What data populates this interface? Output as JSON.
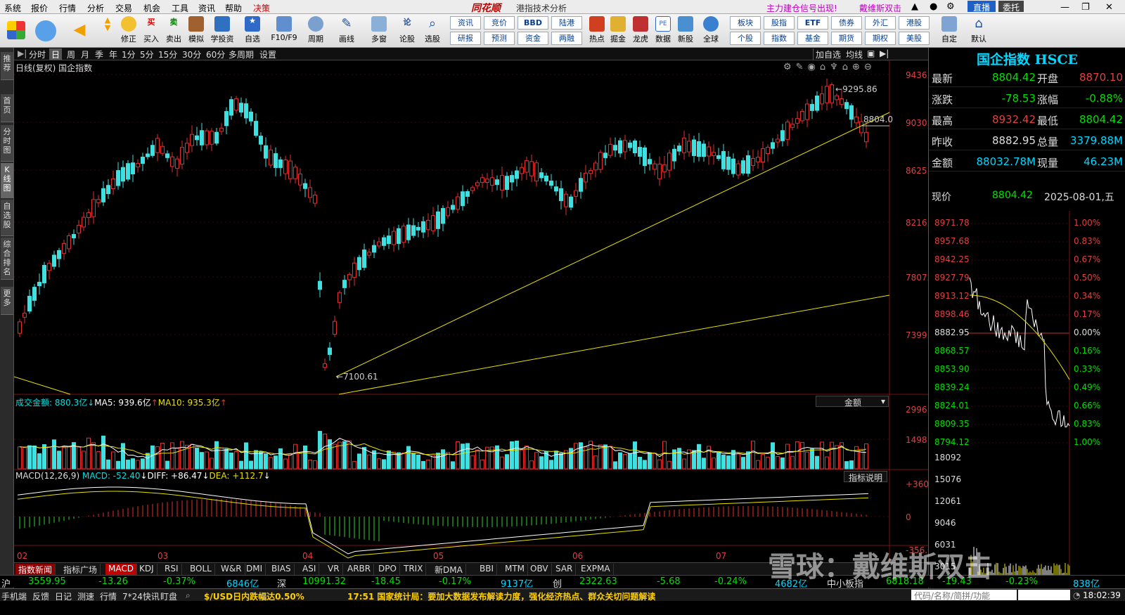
{
  "menu": {
    "items": [
      "系统",
      "报价",
      "行情",
      "分析",
      "交易",
      "机会",
      "工具",
      "资讯",
      "帮助",
      "决策"
    ],
    "brand": "同花顺",
    "title": "港指技术分析",
    "promo1": "主力建仓信号出现!",
    "promo2": "戴维斯双击",
    "live_btn": "直播",
    "delegate_btn": "委托"
  },
  "toolbar": {
    "big": [
      "修正",
      "买入",
      "卖出",
      "模拟",
      "学投资",
      "自选",
      "F10/F9",
      "周期",
      "画线",
      "多窗",
      "论股",
      "选股",
      "热点",
      "掘金",
      "龙虎",
      "数据",
      "新股",
      "全球",
      "自定",
      "默认"
    ],
    "grid_top": [
      "资讯",
      "竞价",
      "BBD",
      "陆港",
      "板块",
      "股指",
      "ETF",
      "债券",
      "外汇",
      "港股"
    ],
    "grid_bottom": [
      "研报",
      "预测",
      "资金",
      "两融",
      "个股",
      "指数",
      "基金",
      "期货",
      "期权",
      "美股"
    ]
  },
  "leftbar": [
    "推荐",
    "首页",
    "分时图",
    "K线图",
    "自选股",
    "综合排名",
    "更多"
  ],
  "periods": [
    "分时",
    "日",
    "周",
    "月",
    "季",
    "年",
    "1分",
    "5分",
    "15分",
    "30分",
    "60分",
    "多周期",
    "设置"
  ],
  "period_right": [
    "加自选",
    "均线"
  ],
  "chart": {
    "header": "日线(复权)  国企指数",
    "high_label": "9295.86",
    "low_label": "7100.61",
    "last_label": "8804.0",
    "yaxis": [
      "9436.03",
      "9030.20",
      "8625.08",
      "8216.86",
      "7807.75",
      "7399.84"
    ],
    "months": [
      "02",
      "03",
      "04",
      "05",
      "06",
      "07"
    ]
  },
  "volume": {
    "label": "成交金额: 880.3亿",
    "ma5": "MA5: 939.6亿",
    "ma10": "MA10: 935.3亿",
    "select": "金额",
    "yaxis": [
      "2996",
      "1498"
    ]
  },
  "macd": {
    "label": "MACD(12,26,9)",
    "macd": "MACD: -52.40",
    "diff": "DIFF: +86.47",
    "dea": "DEA: +112.7",
    "explain": "指标说明",
    "yaxis": [
      "+360.8",
      "0",
      "-356.0"
    ]
  },
  "tabs": [
    "指数新闻",
    "指标广场",
    "MACD",
    "KDJ",
    "RSI",
    "BOLL",
    "W&R",
    "DMI",
    "BIAS",
    "ASI",
    "VR",
    "ARBR",
    "DPO",
    "TRIX",
    "新DMA",
    "BBI",
    "MTM",
    "OBV",
    "SAR",
    "EXPMA"
  ],
  "quote": {
    "title": "国企指数 HSCE",
    "rows": [
      [
        "最新",
        "8804.42",
        "开盘",
        "8870.10"
      ],
      [
        "涨跌",
        "-78.53",
        "涨幅",
        "-0.88%"
      ],
      [
        "最高",
        "8932.42",
        "最低",
        "8804.42"
      ],
      [
        "昨收",
        "8882.95",
        "总量",
        "3379.88M"
      ],
      [
        "金额",
        "88032.78M",
        "现量",
        "46.23M"
      ]
    ],
    "now_label": "现价",
    "now_val": "8804.42",
    "date": "2025-08-01,五",
    "prices": [
      "8971.78",
      "8957.68",
      "8942.25",
      "8927.79",
      "8913.12",
      "8898.46",
      "8882.95",
      "8868.57",
      "8853.90",
      "8839.24",
      "8824.01",
      "8809.35",
      "8794.12"
    ],
    "pcts": [
      "1.00%",
      "0.83%",
      "0.67%",
      "0.50%",
      "0.34%",
      "0.17%",
      "0.00%",
      "0.16%",
      "0.33%",
      "0.49%",
      "0.66%",
      "0.83%",
      "1.00%"
    ],
    "vols": [
      "18092",
      "15076",
      "12061",
      "9046",
      "6031",
      "3015"
    ]
  },
  "ticker": {
    "sh": "沪",
    "sh_val": "3559.95",
    "sh_chg": "-13.26",
    "sh_pct": "-0.37%",
    "sh_amt": "6846亿",
    "sz": "深",
    "sz_val": "10991.32",
    "sz_chg": "-18.45",
    "sz_pct": "-0.17%",
    "sz_amt": "9137亿",
    "cy": "创",
    "cy_val": "2322.63",
    "cy_chg": "-5.68",
    "cy_pct": "-0.24%",
    "cy_amt": "4682亿",
    "zx": "中小板指",
    "zx_val": "6818.18",
    "zx_chg": "-19.43",
    "zx_pct": "-0.23%",
    "zx_amt": "838亿"
  },
  "status": {
    "items": [
      "手机端",
      "反馈",
      "日记",
      "测速",
      "行情",
      "7*24快讯",
      "盯盘"
    ],
    "news1": "$/USD日内跌幅达0.50%",
    "news2": "17:51 国家统计局：要加大数据发布解读力度，强化经济热点、群众关切问题解读",
    "search": "代码/名称/简拼/功能",
    "time": "18:02:39"
  },
  "watermark": "雪球：戴维斯双击"
}
